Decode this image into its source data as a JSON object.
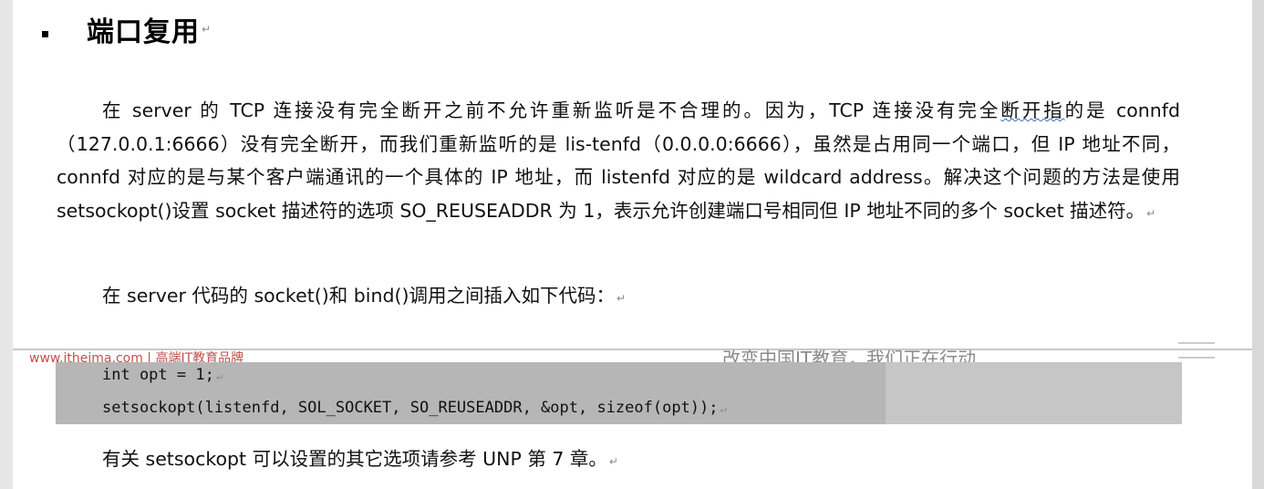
{
  "heading": {
    "text": "端口复用",
    "mark": "↵"
  },
  "paragraph1": {
    "part1": "在 server 的 TCP 连接没有完全断开之前不允许重新监听是不合理的。因为，TCP 连接没有完全",
    "squiggle": "断开指",
    "part2": "的是 connfd（127.0.0.1:6666）没有完全断开，而我们重新监听的是 lis-tenfd（0.0.0.0:6666），虽然是占用同一个端口，但 IP 地址不同，connfd 对应的是与某个客户端通讯的一个具体的 IP 地址，而 listenfd 对应的是 wildcard address。解决这个问题的方法是使用 setsockopt()设置 socket 描述符的选项 SO_REUSEADDR 为 1，表示允许创建端口号相同但 IP 地址不同的多个 socket 描述符。",
    "mark": "↵"
  },
  "paragraph2": {
    "text": "在 server 代码的 socket()和 bind()调用之间插入如下代码：",
    "mark": "↵"
  },
  "footer_ghost": {
    "left": "www.itheima.com | 高端IT教育品牌",
    "right": "改变中国IT教育，我们正在行动"
  },
  "code": {
    "line1": "int opt = 1;",
    "line2": "setsockopt(listenfd, SOL_SOCKET, SO_REUSEADDR, &opt, sizeof(opt));",
    "mark": "↵"
  },
  "paragraph3": {
    "text": "有关 setsockopt 可以设置的其它选项请参考 UNP 第 7 章。",
    "mark": "↵"
  }
}
